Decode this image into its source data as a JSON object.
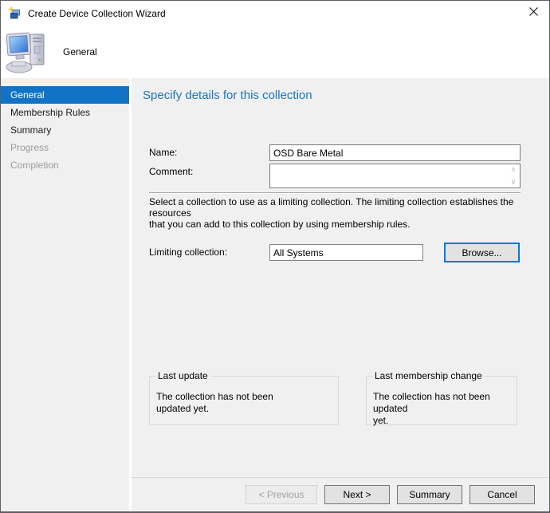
{
  "window": {
    "title": "Create Device Collection Wizard",
    "icons": {
      "titlebar": "collection-wizard-icon",
      "close": "close-x-icon",
      "header": "computer-icon",
      "comment_scroll_up": "chevron-up",
      "comment_scroll_down": "chevron-down"
    }
  },
  "header": {
    "step_label": "General"
  },
  "sidebar": {
    "items": [
      {
        "label": "General",
        "state": "selected"
      },
      {
        "label": "Membership Rules",
        "state": "enabled"
      },
      {
        "label": "Summary",
        "state": "enabled"
      },
      {
        "label": "Progress",
        "state": "disabled"
      },
      {
        "label": "Completion",
        "state": "disabled"
      }
    ]
  },
  "main": {
    "heading": "Specify details for this collection",
    "form": {
      "name_label": "Name:",
      "name_value": "OSD Bare Metal",
      "comment_label": "Comment:",
      "comment_value": "",
      "limiting_description": "Select a collection to use as a limiting collection. The limiting collection establishes the resources\nthat you can add to this collection by using membership rules.",
      "limiting_label": "Limiting collection:",
      "limiting_value": "All Systems",
      "browse_label": "Browse..."
    },
    "info_boxes": [
      {
        "title": "Last update",
        "text": "The collection has not been\nupdated yet."
      },
      {
        "title": "Last membership change",
        "text": "The collection has not been updated\nyet."
      }
    ]
  },
  "footer": {
    "buttons": [
      {
        "label": "< Previous",
        "state": "disabled"
      },
      {
        "label": "Next >",
        "state": "enabled"
      },
      {
        "label": "Summary",
        "state": "enabled"
      },
      {
        "label": "Cancel",
        "state": "enabled"
      }
    ]
  },
  "colors": {
    "accent_blue": "#0078d7",
    "heading_blue": "#1974c5",
    "sidebar_selected": "#1073c6",
    "pane_background": "#f0f0f0"
  }
}
